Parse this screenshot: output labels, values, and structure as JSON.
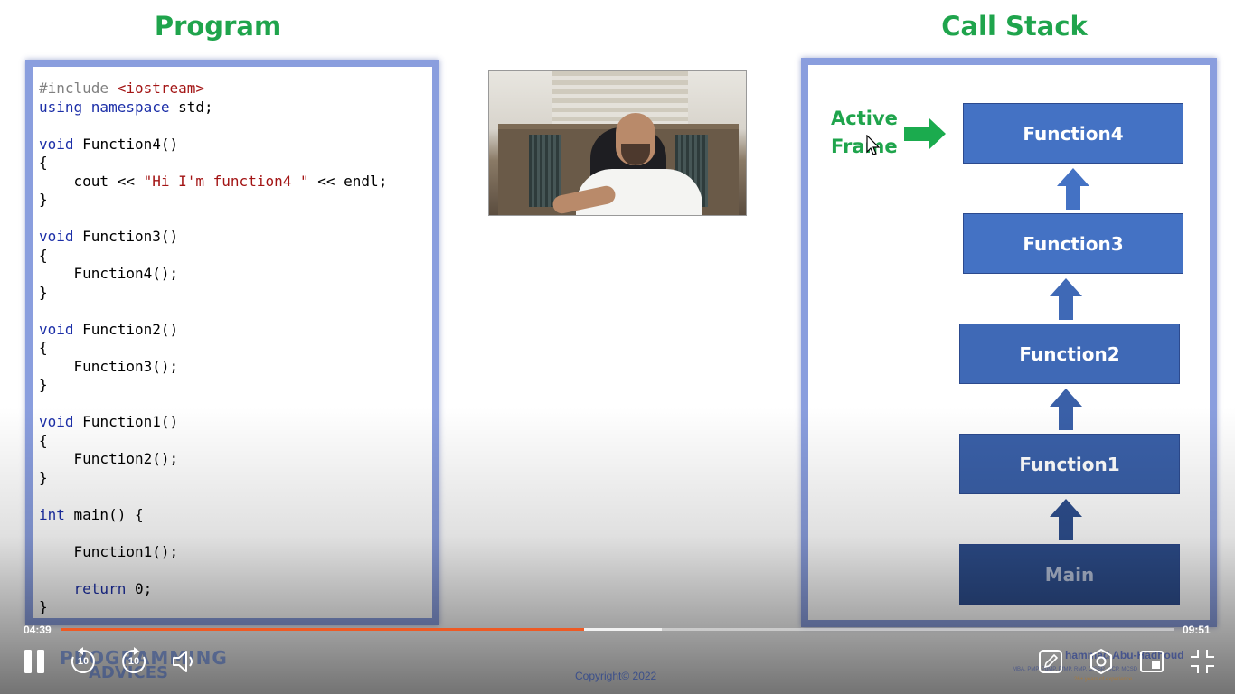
{
  "titles": {
    "program": "Program",
    "call_stack": "Call Stack"
  },
  "code_lines": [
    [
      {
        "t": "#include ",
        "c": "pp"
      },
      {
        "t": "<iostream>",
        "c": "str"
      }
    ],
    [
      {
        "t": "using ",
        "c": "kw"
      },
      {
        "t": "namespace ",
        "c": "kw"
      },
      {
        "t": "std;",
        "c": ""
      }
    ],
    [],
    [
      {
        "t": "void ",
        "c": "kw"
      },
      {
        "t": "Function4()",
        "c": ""
      }
    ],
    [
      {
        "t": "{",
        "c": ""
      }
    ],
    [
      {
        "t": "    cout << ",
        "c": ""
      },
      {
        "t": "\"Hi I'm function4 \"",
        "c": "str"
      },
      {
        "t": " << endl;",
        "c": ""
      }
    ],
    [
      {
        "t": "}",
        "c": ""
      }
    ],
    [],
    [
      {
        "t": "void ",
        "c": "kw"
      },
      {
        "t": "Function3()",
        "c": ""
      }
    ],
    [
      {
        "t": "{",
        "c": ""
      }
    ],
    [
      {
        "t": "    Function4();",
        "c": ""
      }
    ],
    [
      {
        "t": "}",
        "c": ""
      }
    ],
    [],
    [
      {
        "t": "void ",
        "c": "kw"
      },
      {
        "t": "Function2()",
        "c": ""
      }
    ],
    [
      {
        "t": "{",
        "c": ""
      }
    ],
    [
      {
        "t": "    Function3();",
        "c": ""
      }
    ],
    [
      {
        "t": "}",
        "c": ""
      }
    ],
    [],
    [
      {
        "t": "void ",
        "c": "kw"
      },
      {
        "t": "Function1()",
        "c": ""
      }
    ],
    [
      {
        "t": "{",
        "c": ""
      }
    ],
    [
      {
        "t": "    Function2();",
        "c": ""
      }
    ],
    [
      {
        "t": "}",
        "c": ""
      }
    ],
    [],
    [
      {
        "t": "int ",
        "c": "kw"
      },
      {
        "t": "main() {",
        "c": ""
      }
    ],
    [],
    [
      {
        "t": "    Function1();",
        "c": ""
      }
    ],
    [],
    [
      {
        "t": "    ",
        "c": ""
      },
      {
        "t": "return ",
        "c": "kw"
      },
      {
        "t": "0;",
        "c": ""
      }
    ],
    [
      {
        "t": "}",
        "c": ""
      }
    ]
  ],
  "active_frame": {
    "line1": "Active",
    "line2": "Frame"
  },
  "stack_frames": [
    {
      "label": "Function4",
      "color": "#4472c4"
    },
    {
      "label": "Function3",
      "color": "#4472c4"
    },
    {
      "label": "Function2",
      "color": "#3f69b6"
    },
    {
      "label": "Function1",
      "color": "#3a60a8"
    },
    {
      "label": "Main",
      "color": "#2e4f8f"
    }
  ],
  "colors": {
    "title_green": "#1fa44c",
    "progress": "#ee5a24",
    "frame_border": "#8a9ede"
  },
  "player": {
    "current_time": "04:39",
    "total_time": "09:51",
    "progress_fraction": 0.47,
    "buffered_fraction": 0.43,
    "rewind_seconds": "10",
    "forward_seconds": "10",
    "icons": [
      "pause-icon",
      "rewind-10-icon",
      "forward-10-icon",
      "volume-icon",
      "edit-icon",
      "settings-icon",
      "miniplayer-icon",
      "exit-fullscreen-icon"
    ]
  },
  "watermark": {
    "logo_top": "PROGRAMMING",
    "logo_bottom": "ADVICES",
    "copyright": "Copyright© 2022",
    "author": "hammad Abu-Hadhoud",
    "author_sub": "MBA, PMP, PgMP, PfMP, RMP, CISSP, MCP, MCSD",
    "author_sub2": "26+ years of experience"
  }
}
